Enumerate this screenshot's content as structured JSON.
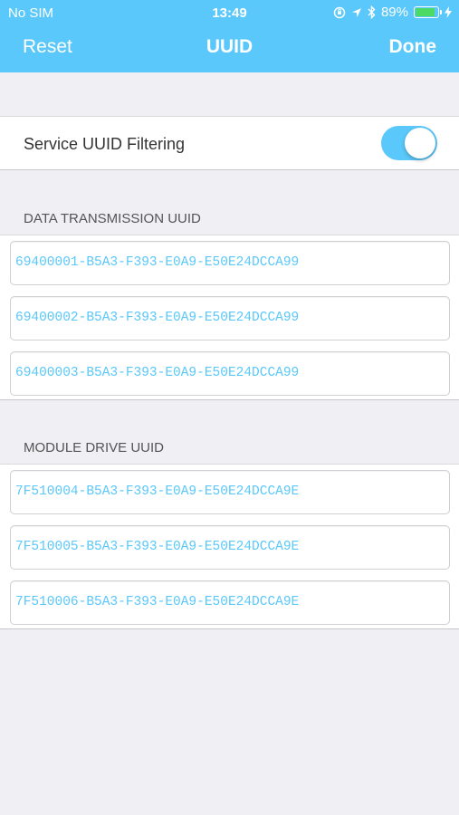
{
  "status": {
    "carrier": "No SIM",
    "time": "13:49",
    "battery": "89%",
    "battery_level": 0.89,
    "icons": [
      "orientation-lock-icon",
      "location-arrow-icon",
      "bluetooth-icon",
      "charging-bolt-icon"
    ]
  },
  "nav": {
    "left": "Reset",
    "title": "UUID",
    "right": "Done",
    "accent_color": "#5ac8fa"
  },
  "filter": {
    "label": "Service UUID Filtering",
    "enabled": true
  },
  "sections": [
    {
      "header": "DATA TRANSMISSION UUID",
      "items": [
        "69400001-B5A3-F393-E0A9-E50E24DCCA99",
        "69400002-B5A3-F393-E0A9-E50E24DCCA99",
        "69400003-B5A3-F393-E0A9-E50E24DCCA99"
      ]
    },
    {
      "header": "MODULE DRIVE UUID",
      "items": [
        "7F510004-B5A3-F393-E0A9-E50E24DCCA9E",
        "7F510005-B5A3-F393-E0A9-E50E24DCCA9E",
        "7F510006-B5A3-F393-E0A9-E50E24DCCA9E"
      ]
    }
  ]
}
